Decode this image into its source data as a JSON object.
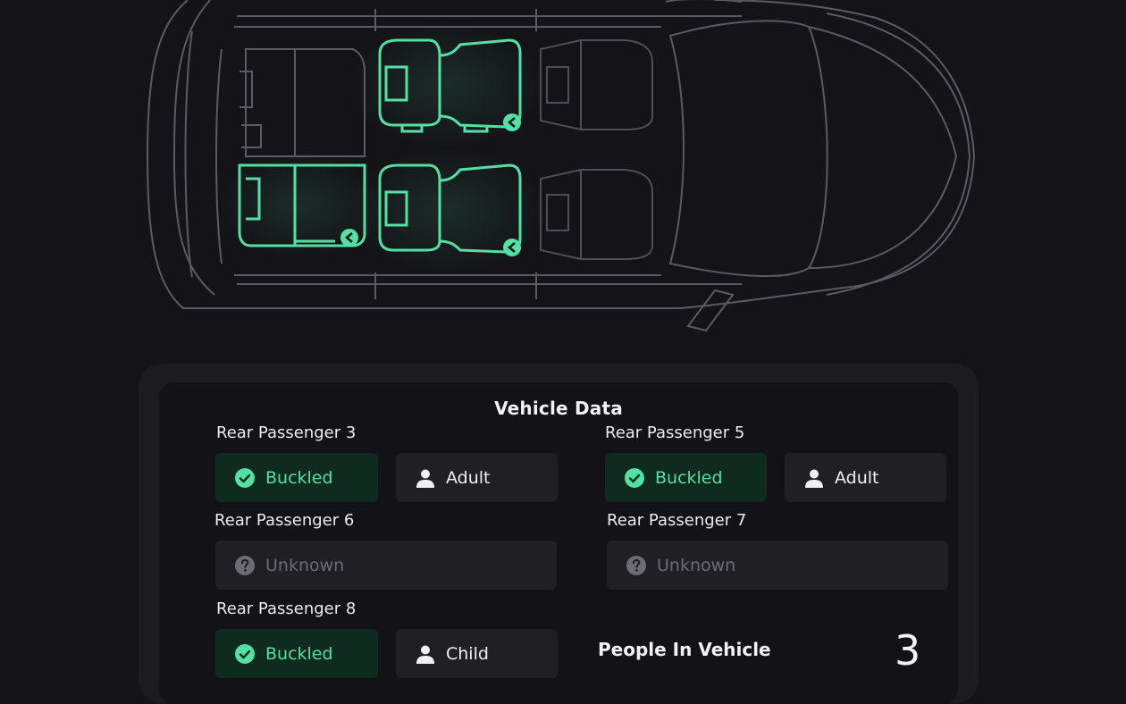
{
  "panel": {
    "title": "Vehicle Data"
  },
  "passengers": [
    {
      "label": "Rear Passenger 3",
      "status": "Buckled",
      "status_icon": "check-circle-icon",
      "type": "Adult",
      "type_icon": "person-icon"
    },
    {
      "label": "Rear Passenger 5",
      "status": "Buckled",
      "status_icon": "check-circle-icon",
      "type": "Adult",
      "type_icon": "person-icon"
    },
    {
      "label": "Rear Passenger 6",
      "status": "Unknown",
      "status_icon": "question-circle-icon"
    },
    {
      "label": "Rear Passenger 7",
      "status": "Unknown",
      "status_icon": "question-circle-icon"
    },
    {
      "label": "Rear Passenger 8",
      "status": "Buckled",
      "status_icon": "check-circle-icon",
      "type": "Child",
      "type_icon": "person-icon"
    }
  ],
  "summary": {
    "people_label": "People In Vehicle",
    "people_count": "3"
  },
  "colors": {
    "background": "#141418",
    "panel": "#131317",
    "accent_green": "#53e0a3",
    "car_outline": "#5a5a60",
    "chip": "#1f1f24",
    "chip_buckled": "#0f2a1e"
  }
}
